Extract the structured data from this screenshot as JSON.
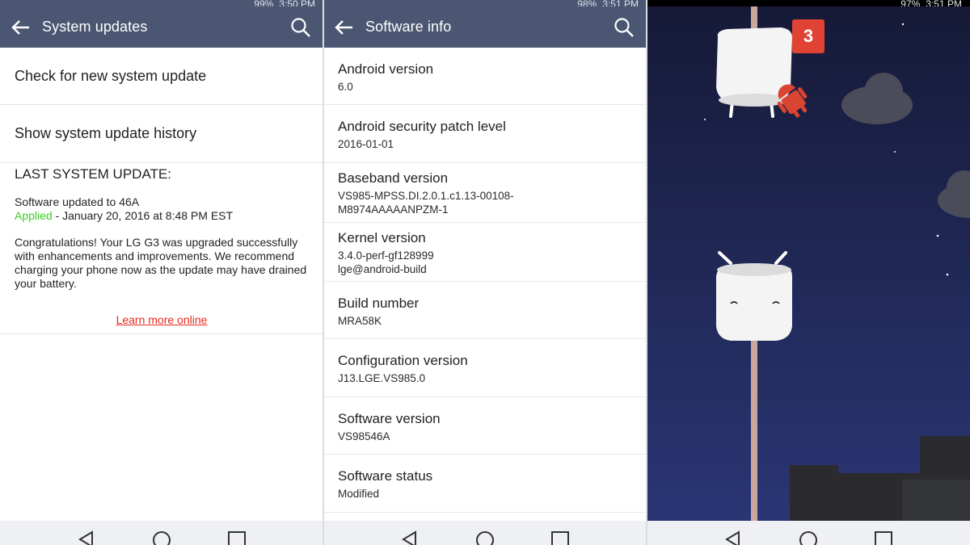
{
  "colors": {
    "appbar": "#4b5672",
    "applied": "#3ccd23",
    "link": "#e8281c",
    "game_sky": "#1b2245",
    "score_badge": "#e04334"
  },
  "status": {
    "left_screen": [
      "99%",
      "3:50 PM"
    ],
    "middle_screen": [
      "98%",
      "3:51 PM"
    ],
    "right_screen": [
      "97%",
      "3:51 PM"
    ]
  },
  "system_updates": {
    "title": "System updates",
    "back_icon": "arrow-left-icon",
    "search_icon": "search-icon",
    "items": [
      {
        "label": "Check for new system update"
      },
      {
        "label": "Show system update history"
      }
    ],
    "last_update": {
      "heading": "LAST SYSTEM UPDATE:",
      "line1": "Software updated to 46A",
      "applied_word": "Applied",
      "applied_rest": " - January 20, 2016 at 8:48 PM EST",
      "message": "Congratulations! Your LG G3 was upgraded successfully with enhancements and improvements. We recommend charging your phone now as the update may have drained your battery.",
      "link": "Learn more online"
    }
  },
  "software_info": {
    "title": "Software info",
    "back_icon": "arrow-left-icon",
    "search_icon": "search-icon",
    "rows": [
      {
        "label": "Android version",
        "value": "6.0"
      },
      {
        "label": "Android security patch level",
        "value": "2016-01-01"
      },
      {
        "label": "Baseband version",
        "value": "VS985-MPSS.DI.2.0.1.c1.13-00108-",
        "value2": "M8974AAAAANPZM-1"
      },
      {
        "label": "Kernel version",
        "value": "3.4.0-perf-gf128999",
        "value2": "lge@android-build"
      },
      {
        "label": "Build number",
        "value": "MRA58K"
      },
      {
        "label": "Configuration version",
        "value": "J13.LGE.VS985.0"
      },
      {
        "label": "Software version",
        "value": "VS98546A"
      },
      {
        "label": "Software status",
        "value": "Modified"
      }
    ]
  },
  "game": {
    "score": "3",
    "characters": [
      "marshmallow-obstacle-top-icon",
      "marshmallow-obstacle-bottom-icon",
      "android-robot-icon"
    ]
  },
  "navigation": {
    "buttons": [
      "back-nav-icon",
      "home-nav-icon",
      "recents-nav-icon"
    ]
  }
}
